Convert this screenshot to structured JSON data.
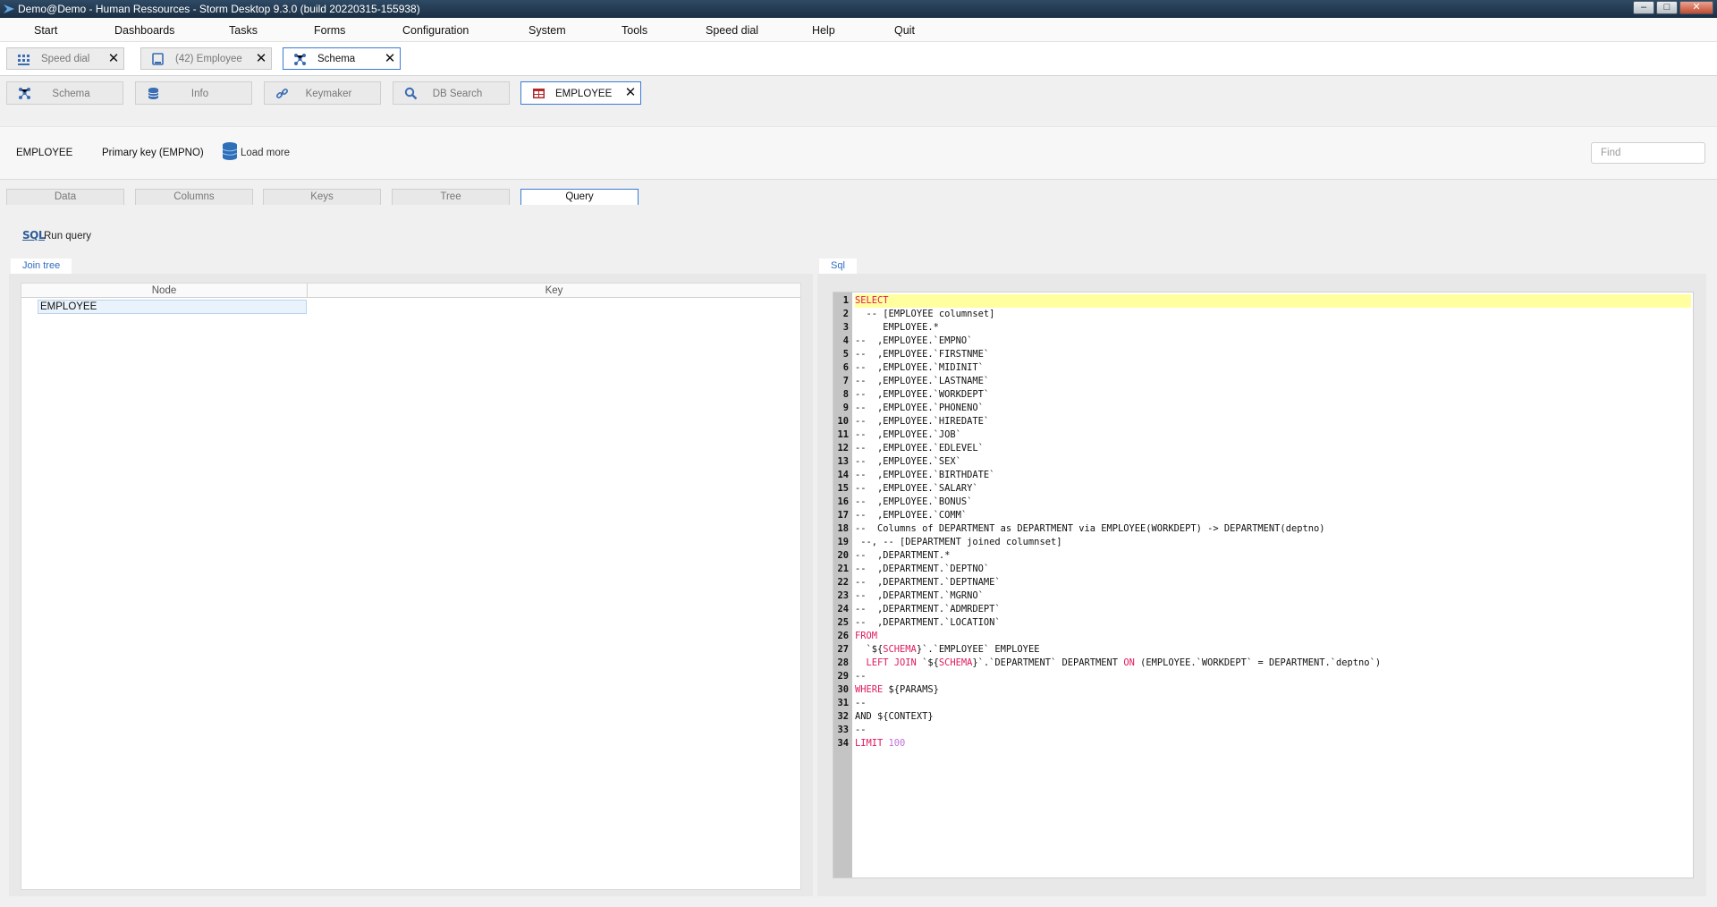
{
  "window": {
    "title": "Demo@Demo - Human Ressources -  Storm Desktop 9.3.0 (build 20220315-155938)"
  },
  "menu": [
    "Start",
    "Dashboards",
    "Tasks",
    "Forms",
    "Configuration",
    "System",
    "Tools",
    "Speed dial",
    "Help",
    "Quit"
  ],
  "doc_tabs": [
    {
      "label": "Speed dial",
      "icon": "speed-dial-icon",
      "closable": true,
      "active": false
    },
    {
      "label": "(42) Employee",
      "icon": "form-icon",
      "closable": true,
      "active": false
    },
    {
      "label": "Schema",
      "icon": "schema-icon",
      "closable": true,
      "active": true
    }
  ],
  "tool_tabs": [
    {
      "label": "Schema",
      "icon": "schema-icon",
      "active": false
    },
    {
      "label": "Info",
      "icon": "database-icon",
      "active": false
    },
    {
      "label": "Keymaker",
      "icon": "link-icon",
      "active": false
    },
    {
      "label": "DB Search",
      "icon": "search-icon",
      "active": false
    },
    {
      "label": "EMPLOYEE",
      "icon": "table-icon",
      "active": true,
      "closable": true
    }
  ],
  "infobar": {
    "table_name": "EMPLOYEE",
    "primary_key": "Primary key (EMPNO)",
    "load_more": "Load more",
    "find_placeholder": "Find"
  },
  "sub_tabs": [
    "Data",
    "Columns",
    "Keys",
    "Tree",
    "Query"
  ],
  "active_sub_tab": "Query",
  "run_query": {
    "icon_text": "SQL",
    "label": "Run query"
  },
  "join_tree": {
    "tab_label": "Join tree",
    "columns": [
      "Node",
      "Key"
    ],
    "rows": [
      {
        "node": "EMPLOYEE",
        "key": ""
      }
    ]
  },
  "sql": {
    "tab_label": "Sql",
    "lines": [
      {
        "n": 1,
        "t": "SELECT"
      },
      {
        "n": 2,
        "t": "  -- [EMPLOYEE columnset]"
      },
      {
        "n": 3,
        "t": "     EMPLOYEE.*"
      },
      {
        "n": 4,
        "t": "--  ,EMPLOYEE.`EMPNO`"
      },
      {
        "n": 5,
        "t": "--  ,EMPLOYEE.`FIRSTNME`"
      },
      {
        "n": 6,
        "t": "--  ,EMPLOYEE.`MIDINIT`"
      },
      {
        "n": 7,
        "t": "--  ,EMPLOYEE.`LASTNAME`"
      },
      {
        "n": 8,
        "t": "--  ,EMPLOYEE.`WORKDEPT`"
      },
      {
        "n": 9,
        "t": "--  ,EMPLOYEE.`PHONENO`"
      },
      {
        "n": 10,
        "t": "--  ,EMPLOYEE.`HIREDATE`"
      },
      {
        "n": 11,
        "t": "--  ,EMPLOYEE.`JOB`"
      },
      {
        "n": 12,
        "t": "--  ,EMPLOYEE.`EDLEVEL`"
      },
      {
        "n": 13,
        "t": "--  ,EMPLOYEE.`SEX`"
      },
      {
        "n": 14,
        "t": "--  ,EMPLOYEE.`BIRTHDATE`"
      },
      {
        "n": 15,
        "t": "--  ,EMPLOYEE.`SALARY`"
      },
      {
        "n": 16,
        "t": "--  ,EMPLOYEE.`BONUS`"
      },
      {
        "n": 17,
        "t": "--  ,EMPLOYEE.`COMM`"
      },
      {
        "n": 18,
        "t": "--  Columns of DEPARTMENT as DEPARTMENT via EMPLOYEE(WORKDEPT) -> DEPARTMENT(deptno)"
      },
      {
        "n": 19,
        "t": " --, -- [DEPARTMENT joined columnset]"
      },
      {
        "n": 20,
        "t": "--  ,DEPARTMENT.*"
      },
      {
        "n": 21,
        "t": "--  ,DEPARTMENT.`DEPTNO`"
      },
      {
        "n": 22,
        "t": "--  ,DEPARTMENT.`DEPTNAME`"
      },
      {
        "n": 23,
        "t": "--  ,DEPARTMENT.`MGRNO`"
      },
      {
        "n": 24,
        "t": "--  ,DEPARTMENT.`ADMRDEPT`"
      },
      {
        "n": 25,
        "t": "--  ,DEPARTMENT.`LOCATION`"
      },
      {
        "n": 26,
        "t": "FROM"
      },
      {
        "n": 27,
        "t": "  `${SCHEMA}`.`EMPLOYEE` EMPLOYEE"
      },
      {
        "n": 28,
        "t": "  LEFT JOIN `${SCHEMA}`.`DEPARTMENT` DEPARTMENT ON (EMPLOYEE.`WORKDEPT` = DEPARTMENT.`deptno`)"
      },
      {
        "n": 29,
        "t": "--"
      },
      {
        "n": 30,
        "t": "WHERE ${PARAMS}"
      },
      {
        "n": 31,
        "t": "--"
      },
      {
        "n": 32,
        "t": "AND ${CONTEXT}"
      },
      {
        "n": 33,
        "t": "--"
      },
      {
        "n": 34,
        "t": "LIMIT 100"
      }
    ],
    "highlight_line": 1
  },
  "colors": {
    "accent": "#3a7bd5",
    "keyword": "#e0195a",
    "number": "#c070d8",
    "current_line": "#ffffa0",
    "gutter": "#c4c4c4"
  }
}
